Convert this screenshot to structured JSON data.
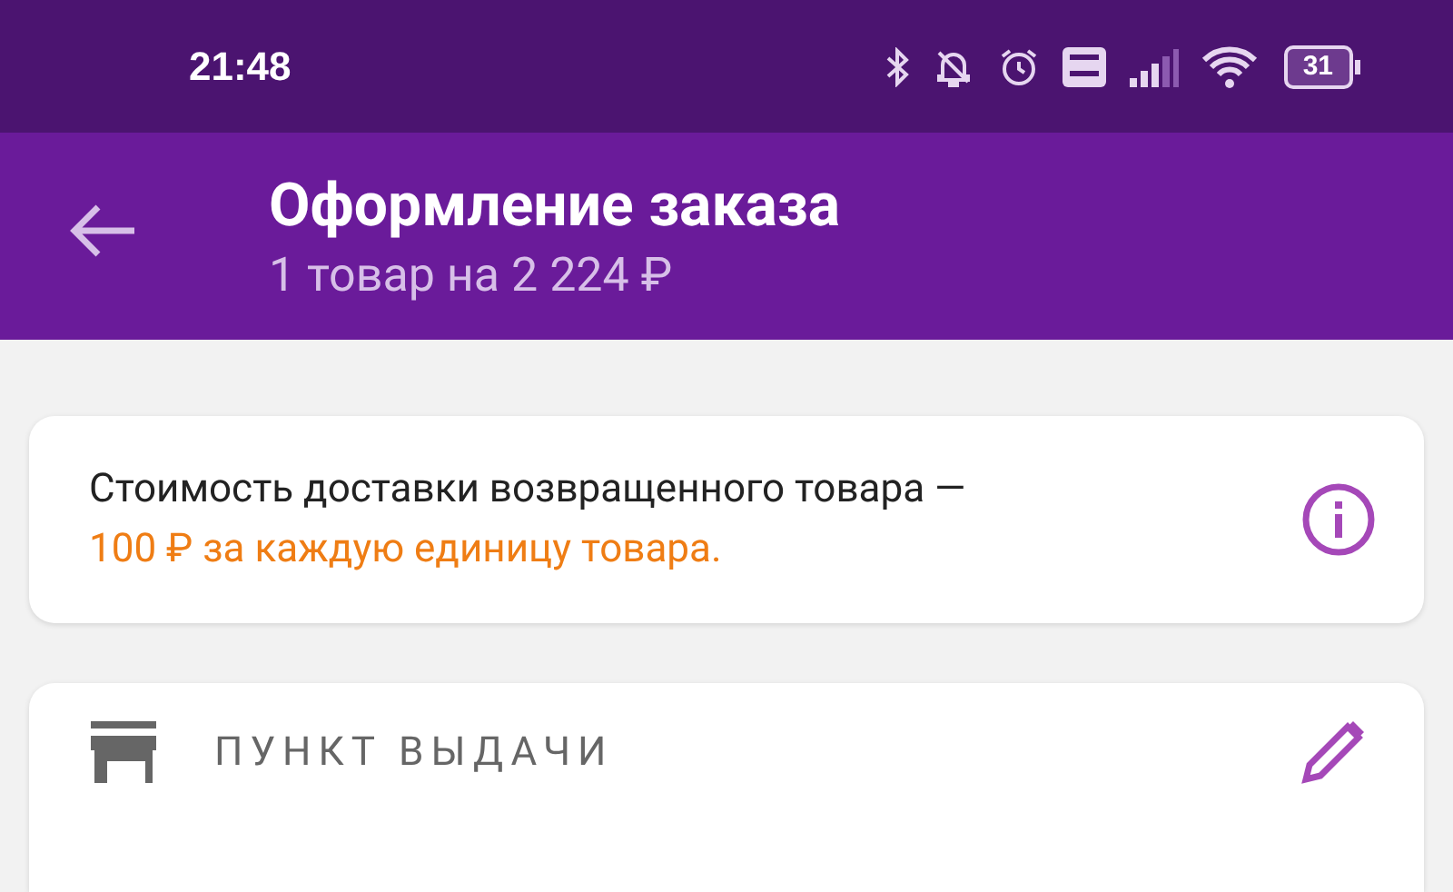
{
  "status_bar": {
    "time": "21:48",
    "battery": "31"
  },
  "header": {
    "title": "Оформление заказа",
    "subtitle": "1 товар на 2 224 ₽"
  },
  "notice": {
    "text": "Стоимость доставки возвращенного товара —",
    "highlight": "100 ₽ за каждую единицу товара."
  },
  "section": {
    "title": "ПУНКТ ВЫДАЧИ"
  }
}
